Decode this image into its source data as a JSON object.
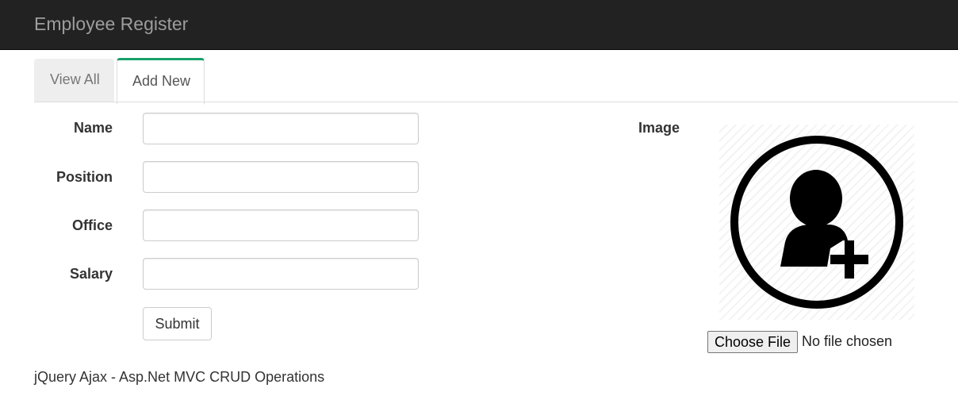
{
  "navbar": {
    "brand": "Employee Register"
  },
  "tabs": [
    {
      "label": "View All",
      "active": false
    },
    {
      "label": "Add New",
      "active": true
    }
  ],
  "form": {
    "fields": [
      {
        "label": "Name",
        "value": ""
      },
      {
        "label": "Position",
        "value": ""
      },
      {
        "label": "Office",
        "value": ""
      },
      {
        "label": "Salary",
        "value": ""
      }
    ],
    "submit_label": "Submit"
  },
  "image": {
    "label": "Image",
    "icon": "add-user-icon",
    "file_button_label": "Choose File",
    "file_status": "No file chosen"
  },
  "footer": {
    "text": "jQuery Ajax - Asp.Net MVC CRUD Operations"
  },
  "colors": {
    "navbar_bg": "#222222",
    "brand": "#9d9d9d",
    "active_tab_accent": "#18a06a"
  }
}
